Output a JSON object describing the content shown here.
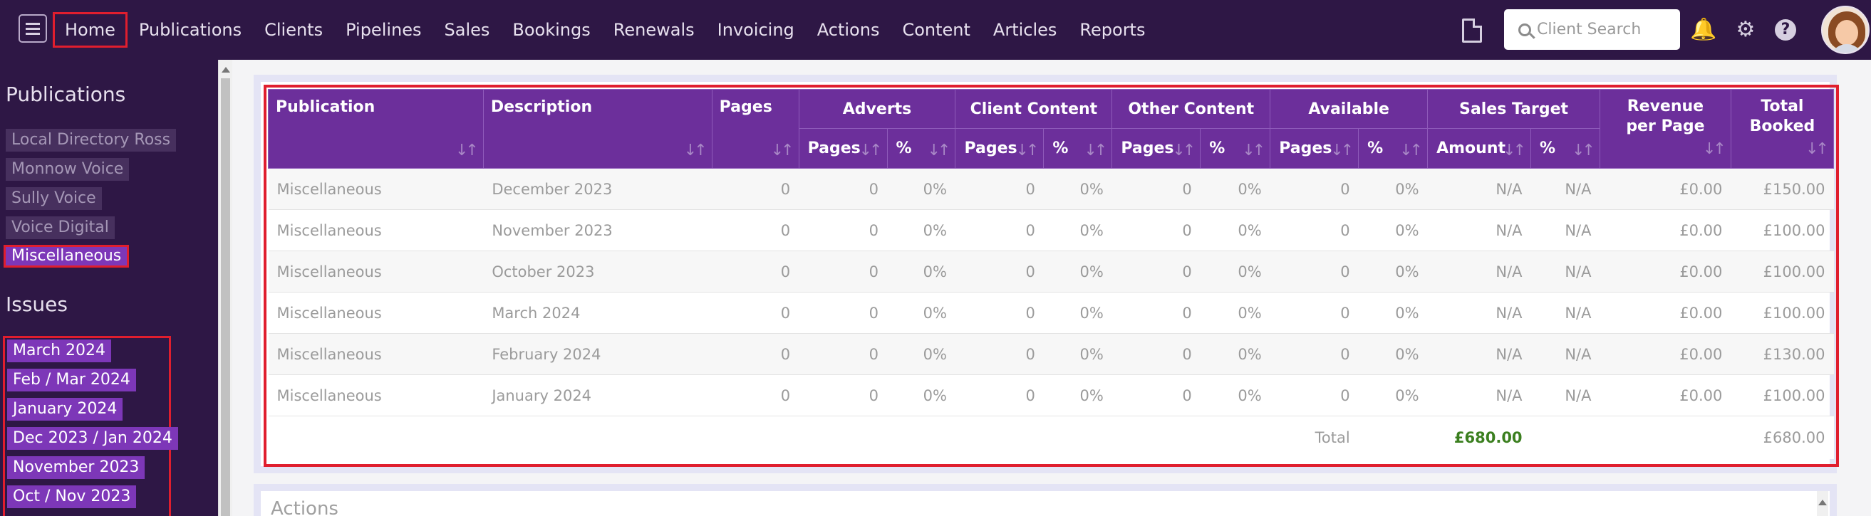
{
  "nav": {
    "items": [
      "Home",
      "Publications",
      "Clients",
      "Pipelines",
      "Sales",
      "Bookings",
      "Renewals",
      "Invoicing",
      "Actions",
      "Content",
      "Articles",
      "Reports"
    ],
    "search_placeholder": "Client Search",
    "icons": {
      "menu": "hamburger-menu-icon",
      "document": "document-image-icon",
      "search": "search-icon",
      "notifications": "bell-icon",
      "settings": "gear-icon",
      "help": "question-circle-icon"
    },
    "help_glyph": "?",
    "bell_glyph": "🔔",
    "gear_glyph": "⚙"
  },
  "sidebar": {
    "publications_heading": "Publications",
    "publications": [
      "Local Directory Ross",
      "Monnow Voice",
      "Sully Voice",
      "Voice Digital",
      "Miscellaneous"
    ],
    "issues_heading": "Issues",
    "issues": [
      "March 2024",
      "Feb / Mar 2024",
      "January 2024",
      "Dec 2023 / Jan 2024",
      "November 2023",
      "Oct / Nov 2023"
    ]
  },
  "table": {
    "headers": {
      "publication": "Publication",
      "description": "Description",
      "pages": "Pages",
      "adverts": "Adverts",
      "client_content": "Client Content",
      "other_content": "Other Content",
      "available": "Available",
      "sales_target": "Sales Target",
      "revenue_per_page_1": "Revenue",
      "revenue_per_page_2": "per Page",
      "total_booked_1": "Total",
      "total_booked_2": "Booked",
      "sub_pages": "Pages",
      "sub_pct": "%",
      "sub_amount": "Amount"
    },
    "sort_glyph": "↓↑",
    "rows": [
      {
        "publication": "Miscellaneous",
        "description": "December 2023",
        "pages": "0",
        "adv_pages": "0",
        "adv_pct": "0%",
        "cc_pages": "0",
        "cc_pct": "0%",
        "oc_pages": "0",
        "oc_pct": "0%",
        "av_pages": "0",
        "av_pct": "0%",
        "st_amount": "N/A",
        "st_pct": "N/A",
        "revenue": "£0.00",
        "total": "£150.00"
      },
      {
        "publication": "Miscellaneous",
        "description": "November 2023",
        "pages": "0",
        "adv_pages": "0",
        "adv_pct": "0%",
        "cc_pages": "0",
        "cc_pct": "0%",
        "oc_pages": "0",
        "oc_pct": "0%",
        "av_pages": "0",
        "av_pct": "0%",
        "st_amount": "N/A",
        "st_pct": "N/A",
        "revenue": "£0.00",
        "total": "£100.00"
      },
      {
        "publication": "Miscellaneous",
        "description": "October 2023",
        "pages": "0",
        "adv_pages": "0",
        "adv_pct": "0%",
        "cc_pages": "0",
        "cc_pct": "0%",
        "oc_pages": "0",
        "oc_pct": "0%",
        "av_pages": "0",
        "av_pct": "0%",
        "st_amount": "N/A",
        "st_pct": "N/A",
        "revenue": "£0.00",
        "total": "£100.00"
      },
      {
        "publication": "Miscellaneous",
        "description": "March 2024",
        "pages": "0",
        "adv_pages": "0",
        "adv_pct": "0%",
        "cc_pages": "0",
        "cc_pct": "0%",
        "oc_pages": "0",
        "oc_pct": "0%",
        "av_pages": "0",
        "av_pct": "0%",
        "st_amount": "N/A",
        "st_pct": "N/A",
        "revenue": "£0.00",
        "total": "£100.00"
      },
      {
        "publication": "Miscellaneous",
        "description": "February 2024",
        "pages": "0",
        "adv_pages": "0",
        "adv_pct": "0%",
        "cc_pages": "0",
        "cc_pct": "0%",
        "oc_pages": "0",
        "oc_pct": "0%",
        "av_pages": "0",
        "av_pct": "0%",
        "st_amount": "N/A",
        "st_pct": "N/A",
        "revenue": "£0.00",
        "total": "£130.00"
      },
      {
        "publication": "Miscellaneous",
        "description": "January 2024",
        "pages": "0",
        "adv_pages": "0",
        "adv_pct": "0%",
        "cc_pages": "0",
        "cc_pct": "0%",
        "oc_pages": "0",
        "oc_pct": "0%",
        "av_pages": "0",
        "av_pct": "0%",
        "st_amount": "N/A",
        "st_pct": "N/A",
        "revenue": "£0.00",
        "total": "£100.00"
      }
    ],
    "total_label": "Total",
    "total_sales": "£680.00",
    "total_booked": "£680.00"
  },
  "actions": {
    "title": "Actions"
  },
  "colors": {
    "nav_bg": "#2e1745",
    "header_bg": "#6c2f9b",
    "selected_pill": "#7d37b8",
    "highlight": "#e01e2e",
    "total_green": "#3b7f1f"
  }
}
